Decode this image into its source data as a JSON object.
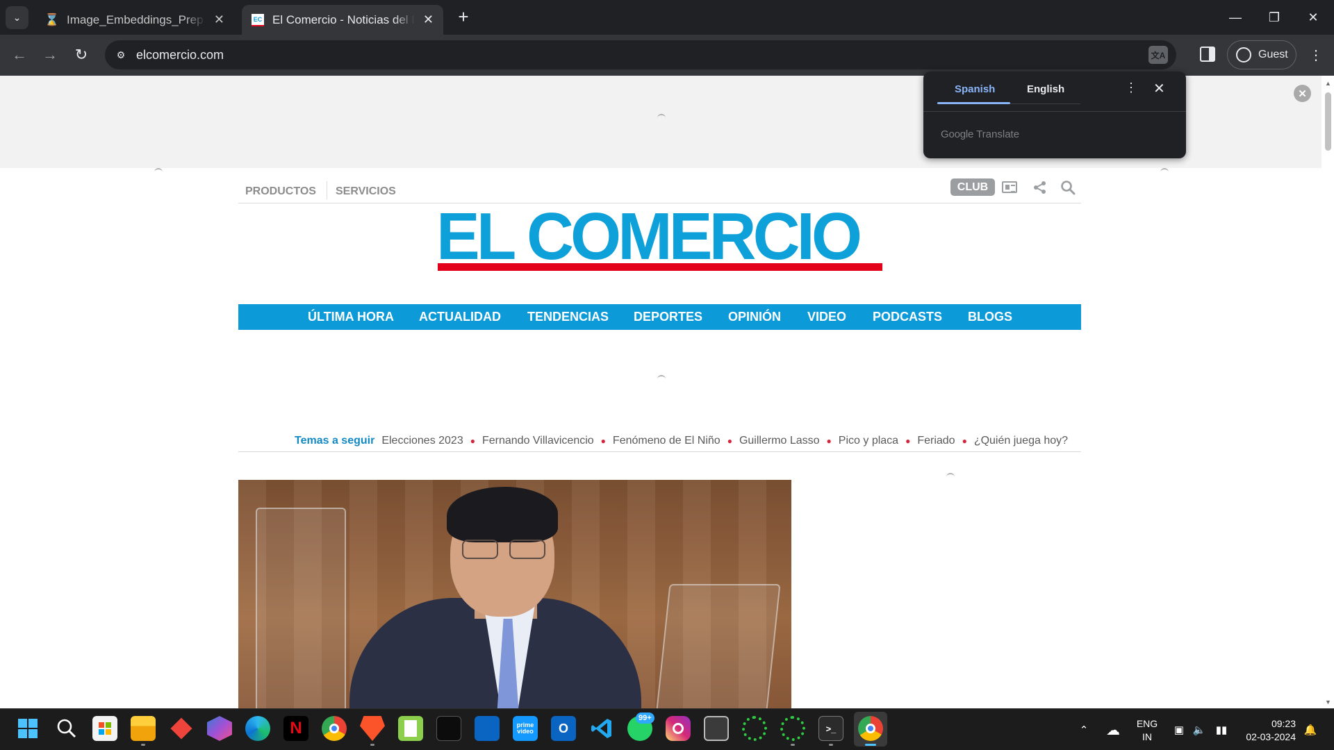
{
  "browser": {
    "tabs": [
      {
        "title": "Image_Embeddings_Prep - Jupyter",
        "active": false
      },
      {
        "title": "El Comercio - Noticias del Ecuador",
        "active": true,
        "favicon_text": "EC"
      }
    ],
    "url": "elcomercio.com",
    "profile_label": "Guest"
  },
  "translate_popup": {
    "tabs": [
      "Spanish",
      "English"
    ],
    "selected": "Spanish",
    "brand": "Google",
    "product": "Translate"
  },
  "site": {
    "top_links": [
      "PRODUCTOS",
      "SERVICIOS"
    ],
    "club_label": "CLUB",
    "logo_text": "EL COMERCIO",
    "main_nav": [
      "ÚLTIMA HORA",
      "ACTUALIDAD",
      "TENDENCIAS",
      "DEPORTES",
      "OPINIÓN",
      "VIDEO",
      "PODCASTS",
      "BLOGS"
    ],
    "temas_label": "Temas a seguir",
    "temas": [
      "Elecciones 2023",
      "Fernando Villavicencio",
      "Fenómeno de El Niño",
      "Guillermo Lasso",
      "Pico y placa",
      "Feriado",
      "¿Quién juega hoy?"
    ]
  },
  "taskbar": {
    "apps": [
      "start",
      "search",
      "store",
      "file-explorer",
      "anydesk",
      "copilot",
      "edge",
      "netflix",
      "chrome",
      "brave",
      "notepad-plus",
      "terminal-cmd",
      "microsoft-store-blue",
      "prime-video",
      "outlook",
      "vscode",
      "whatsapp",
      "instagram",
      "window-app",
      "loader-app-1",
      "loader-app-2",
      "terminal",
      "chrome-active"
    ],
    "whatsapp_badge": "99+",
    "prime_label": "prime video",
    "language": {
      "line1": "ENG",
      "line2": "IN"
    },
    "time": "09:23",
    "date": "02-03-2024"
  }
}
